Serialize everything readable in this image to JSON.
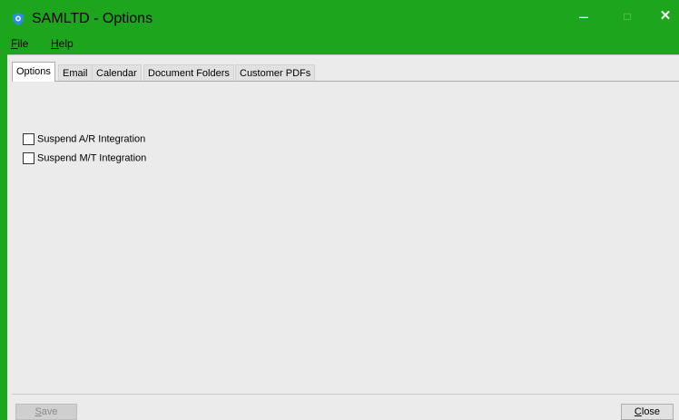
{
  "window": {
    "title": "SAMLTD - Options",
    "controls": {
      "minimize": "–",
      "maximize": "□",
      "close": "✕"
    }
  },
  "menu": {
    "file_mnemonic": "F",
    "file_rest": "ile",
    "help_mnemonic": "H",
    "help_rest": "elp"
  },
  "tabs": [
    {
      "label": "Options",
      "active": true
    },
    {
      "label": "Email",
      "active": false
    },
    {
      "label": "Calendar",
      "active": false
    },
    {
      "label": "Document Folders",
      "active": false
    },
    {
      "label": "Customer PDFs",
      "active": false
    }
  ],
  "options": {
    "suspend_ar": {
      "label": "Suspend A/R Integration",
      "checked": false
    },
    "suspend_mt": {
      "label": "Suspend M/T Integration",
      "checked": false
    }
  },
  "buttons": {
    "save_mnemonic": "S",
    "save_rest": "ave",
    "save_enabled": false,
    "close_mnemonic": "C",
    "close_rest": "lose"
  },
  "colors": {
    "titlebar": "#1ea51e",
    "client": "#ebebeb",
    "app_icon": "#2a8de0"
  }
}
